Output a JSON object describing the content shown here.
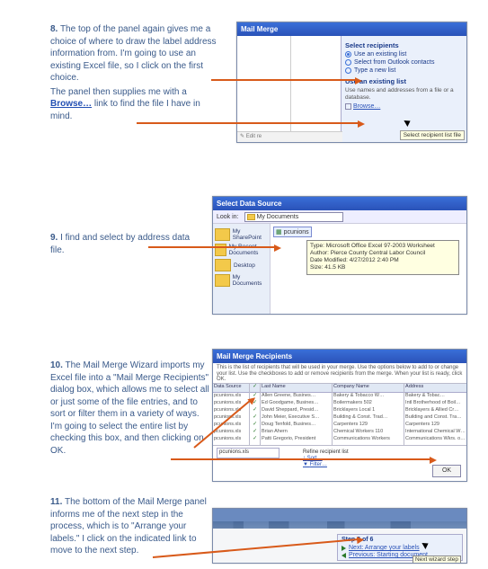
{
  "step8": {
    "num": "8.",
    "text_a": "The top of the panel again gives me a choice of where to draw the label address information from.  I'm going to use an existing Excel file, so I click on the first choice.",
    "text_b": "The panel then supplies me with a ",
    "browse_label": "Browse…",
    "text_c": " link to find the file I have in mind.",
    "panel": {
      "title": "Mail Merge",
      "section1": "Select recipients",
      "opt1": "Use an existing list",
      "opt2": "Select from Outlook contacts",
      "opt3": "Type a new list",
      "section2": "Use an existing list",
      "desc": "Use names and addresses from a file or a database.",
      "browse": "Browse…",
      "tooltip": "Select recipient list file",
      "edit": "Edit re"
    }
  },
  "step9": {
    "num": "9.",
    "text": "I find and select by address data file.",
    "window_title": "Select Data Source",
    "lookin_label": "Look in:",
    "lookin_value": "My Documents",
    "side_items": [
      "My SharePoint",
      "My Recent Documents",
      "Desktop",
      "My Documents"
    ],
    "filename": "pcunions",
    "tooltip_line1": "Type: Microsoft Office Excel 97-2003 Worksheet",
    "tooltip_line2": "Author: Pierce County Central Labor Council",
    "tooltip_line3": "Date Modified: 4/27/2012 2:40 PM",
    "tooltip_line4": "Size: 41.5 KB"
  },
  "step10": {
    "num": "10.",
    "text": "The Mail Merge Wizard imports my Excel file into a \"Mail Merge Recipients\" dialog box, which allows me to select all or just some of the file entries, and to sort or filter them in a variety of ways.   I'm going to select the entire list by checking this box, and then clicking on OK.",
    "window_title": "Mail Merge Recipients",
    "desc": "This is the list of recipients that will be used in your merge. Use the options below to add to or change your list. Use the checkboxes to add or remove recipients from the merge. When your list is ready, click OK.",
    "headers": {
      "src": "Data Source",
      "name": "Last Name",
      "comp": "Company Name",
      "addr": "Address"
    },
    "rows_src": [
      "pcunions.xls",
      "pcunions.xls",
      "pcunions.xls",
      "pcunions.xls",
      "pcunions.xls",
      "pcunions.xls",
      "pcunions.xls"
    ],
    "rows_name": [
      "Allen Greene, Busines…",
      "Ed Goodgame, Busines…",
      "David Sheppard, Presid…",
      "John Meier, Executive S…",
      "Doug Tenfold, Busines…",
      "Brian Ahern",
      "Patti Gregorio, President"
    ],
    "rows_comp": [
      "Bakery & Tobacco W…",
      "Boilermakers 502",
      "Bricklayers Local 1",
      "Building & Const. Trad…",
      "Carpenters 129",
      "Chemical Workers 110",
      "Communications Workers"
    ],
    "rows_addr": [
      "Bakery & Tobac…",
      "Intl Brotherhood of Boil…",
      "Bricklayers & Allied Cr…",
      "Building and Const. Tra…",
      "Carpenters 129",
      "International Chemical W…",
      "Communications Wkrs. o…"
    ],
    "refine_label": "Refine recipient list",
    "link_sort": "Sort…",
    "link_filter": "Filter…",
    "src_value": "pcunions.xls",
    "ok": "OK"
  },
  "step11": {
    "num": "11.",
    "text": "The bottom of the Mail Merge panel informs me of the next step in the process, which is to \"Arrange your labels.\"  I click on the indicated link to move to the next step.",
    "step_label": "Step 3 of 6",
    "next": "Next: Arrange your labels",
    "prev": "Previous: Starting document",
    "tooltip": "Next wizard step"
  }
}
